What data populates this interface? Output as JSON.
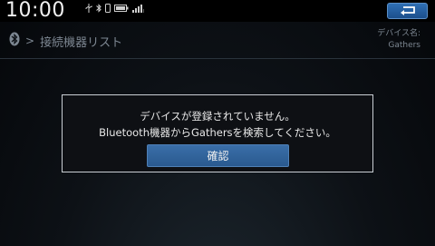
{
  "status_bar": {
    "time": "10:00",
    "icons": [
      "usb-icon",
      "bluetooth-icon",
      "phone-icon",
      "battery-icon",
      "signal-icon"
    ]
  },
  "header": {
    "breadcrumb_icon": "bluetooth-icon",
    "breadcrumb_separator": ">",
    "title": "接続機器リスト",
    "device_name_label": "デバイス名:",
    "device_name_value": "Gathers",
    "back_button_icon": "return-arrow-icon"
  },
  "dialog": {
    "line1": "デバイスが登録されていません。",
    "line2": "Bluetooth機器からGathersを検索してください。",
    "confirm_label": "確認"
  },
  "colors": {
    "accent_button": "#2a5a8f",
    "back_button": "#1c4f8c",
    "dialog_border": "#c9ced4"
  }
}
